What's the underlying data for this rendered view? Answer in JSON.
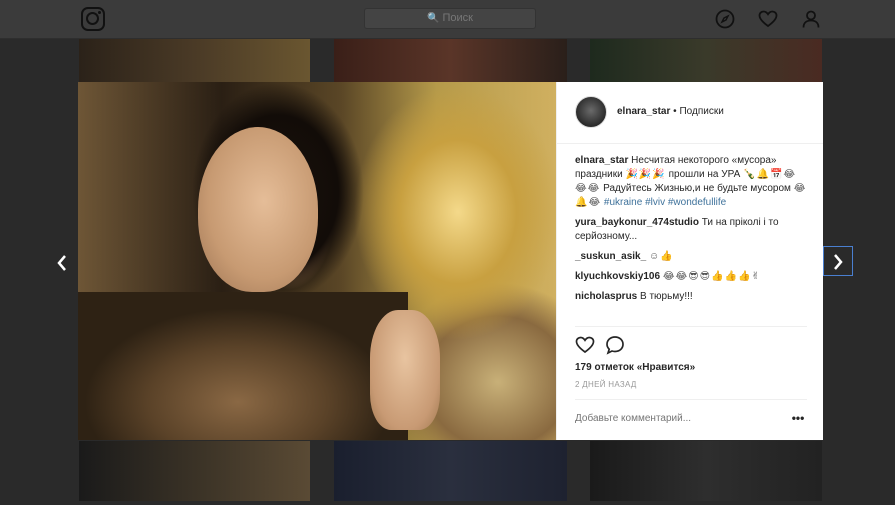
{
  "header": {
    "search": {
      "placeholder": "Поиск",
      "icon": "search-icon"
    },
    "icons": [
      "compass-icon",
      "heart-icon",
      "person-icon"
    ]
  },
  "post": {
    "username": "elnara_star",
    "separator": "•",
    "follow_label": "Подписки",
    "caption": {
      "username": "elnara_star",
      "text_1": "Несчитая некоторого «мусора» праздники",
      "emoji_1": "🎉🎉🎉",
      "text_2": "прошли на УРА",
      "emoji_2": "🍾🔔📅😂😂😂",
      "text_3": "Радуйтесь Жизнью,и не будьте мусором",
      "emoji_3": "😂🔔😂",
      "hashtags": [
        "#ukraine",
        "#lviv",
        "#wondefullife"
      ]
    },
    "comments": [
      {
        "username": "yura_baykonur_474studio",
        "text": "Ти на пріколі і то серйозному..."
      },
      {
        "username": "_suskun_asik_",
        "text": "☺👍"
      },
      {
        "username": "klyuchkovskiy106",
        "text": "😂😂😎😎👍👍👍✌"
      },
      {
        "username": "nicholasprus",
        "text": "В тюрьму!!!"
      }
    ],
    "likes": "179 отметок «Нравится»",
    "timestamp": "2 ДНЕЙ НАЗАД",
    "add_comment_placeholder": "Добавьте комментарий...",
    "more": "•••"
  },
  "colors": {
    "hashtag": "#3f729b",
    "text": "#262626",
    "muted": "#999999",
    "overlay": "#2a2a2a"
  }
}
